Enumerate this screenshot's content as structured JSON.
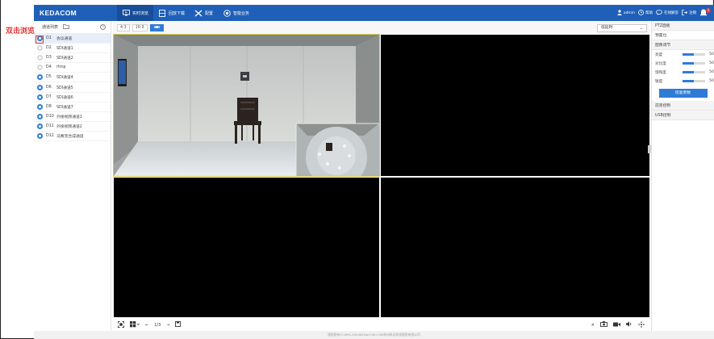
{
  "header": {
    "logo": "KEDACOM",
    "nav": [
      {
        "label": "实时浏览",
        "icon": "monitor-icon",
        "active": true
      },
      {
        "label": "回放下载",
        "icon": "film-icon",
        "active": false
      },
      {
        "label": "配置",
        "icon": "tools-icon",
        "active": false
      },
      {
        "label": "智能业务",
        "icon": "smart-icon",
        "active": false
      }
    ],
    "user": "admin",
    "help": "帮助",
    "consult": "在线解答",
    "logout": "注销",
    "alarm_count": "1"
  },
  "channel_panel": {
    "title": "通道列表",
    "hint": "双击浏览",
    "channels": [
      {
        "id": "D1",
        "name": "会议通道",
        "online": true
      },
      {
        "id": "D2",
        "name": "SDI通道1",
        "online": false
      },
      {
        "id": "D3",
        "name": "SDI通道2",
        "online": false
      },
      {
        "id": "D4",
        "name": "rtmp",
        "online": false
      },
      {
        "id": "D5",
        "name": "SDI通道4",
        "online": true
      },
      {
        "id": "D6",
        "name": "SDI通道5",
        "online": true
      },
      {
        "id": "D7",
        "name": "SDI通道6",
        "online": true
      },
      {
        "id": "D8",
        "name": "SDI通道7",
        "online": true
      },
      {
        "id": "D10",
        "name": "外接视频通道1",
        "online": true
      },
      {
        "id": "D11",
        "name": "外接视频通道2",
        "online": true
      },
      {
        "id": "D12",
        "name": "马赛克合成通道",
        "online": true
      }
    ]
  },
  "video_toolbar": {
    "ratio_43": "4:3",
    "ratio_169": "16:9",
    "stream": "低延时"
  },
  "bottom_bar": {
    "page": "1/3"
  },
  "right_panel": {
    "ptz": "PTZ面板",
    "preset": "预置位",
    "image_adjust": "图像调节",
    "sliders": [
      {
        "label": "亮度",
        "value": 50
      },
      {
        "label": "对比度",
        "value": 50
      },
      {
        "label": "饱和度",
        "value": 50
      },
      {
        "label": "锐度",
        "value": 50
      }
    ],
    "reset_button": "恢复参数",
    "zoom_control": "前景控制",
    "usb_control": "USB控制"
  },
  "footer": {
    "copyright": "版权所有©1995-2024KEDACOM,COM苏州科达科技股份有限公司"
  },
  "colors": {
    "header": "#1f5fb8",
    "accent": "#2e7bd6",
    "hint": "#e53935"
  }
}
